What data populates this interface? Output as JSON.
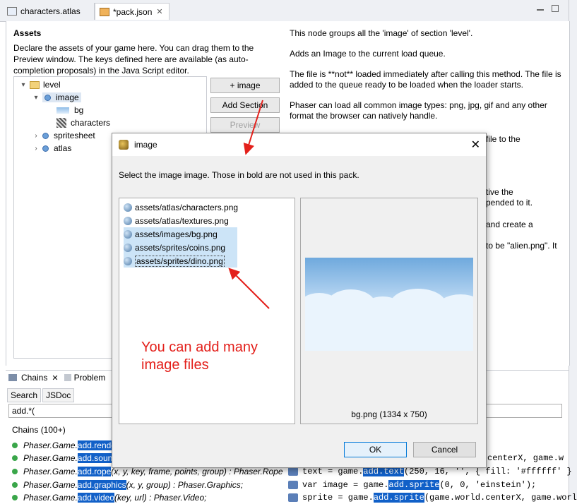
{
  "editor_tabs": [
    {
      "label": "characters.atlas",
      "icon": "atlas-file-icon"
    },
    {
      "label": "*pack.json",
      "icon": "pack-file-icon"
    }
  ],
  "assets_section": {
    "title": "Assets",
    "description": "Declare the assets of your game here. You can drag them to the Preview window. The keys defined here are available (as auto-completion proposals) in the Java Script editor.",
    "tree": [
      {
        "label": "level",
        "icon": "folder-icon"
      },
      {
        "label": "image",
        "icon": "section-icon"
      },
      {
        "label": "bg",
        "icon": "image-thumbnail-icon"
      },
      {
        "label": "characters",
        "icon": "atlas-thumbnail-icon"
      },
      {
        "label": "spritesheet",
        "icon": "section-icon"
      },
      {
        "label": "atlas",
        "icon": "section-icon"
      }
    ],
    "buttons": {
      "add_image": "+ image",
      "add_section": "Add Section",
      "preview": "Preview"
    }
  },
  "help_text": [
    "This node groups all the 'image' of section 'level'.",
    "Adds an Image to the current load queue.",
    "The file is **not** loaded immediately after calling this method. The file is added to the queue ready to be loaded when the loader starts.",
    "Phaser can load all common image types: png, jpg, gif and any other format the browser can natively handle."
  ],
  "help_fragments": [
    "file to the",
    "tive the",
    "pended to it.",
    "and create a",
    "to be \"alien.png\". It"
  ],
  "dialog": {
    "title": "image",
    "message": "Select the image image. Those in bold are not used in this pack.",
    "files": [
      {
        "path": "assets/atlas/characters.png",
        "selected": false
      },
      {
        "path": "assets/atlas/textures.png",
        "selected": false
      },
      {
        "path": "assets/images/bg.png",
        "selected": true
      },
      {
        "path": "assets/sprites/coins.png",
        "selected": true
      },
      {
        "path": "assets/sprites/dino.png",
        "selected": true
      }
    ],
    "preview_caption": "bg.png (1334 x 750)",
    "ok_label": "OK",
    "cancel_label": "Cancel"
  },
  "annotation": "You can add many image files",
  "bottom_panel": {
    "tabs": [
      "Chains",
      "Problem"
    ],
    "subtabs": [
      "Search",
      "JSDoc"
    ],
    "query": "add.*(",
    "chains_label": "Chains (100+)",
    "chains": [
      {
        "prefix": "Phaser.Game.",
        "match": "add.rende",
        "rest": ""
      },
      {
        "prefix": "Phaser.Game.",
        "match": "add.sound",
        "rest": ""
      },
      {
        "prefix": "Phaser.Game.",
        "match": "add.rope",
        "rest": "(x, y, key, frame, points, group) : Phaser.Rope"
      },
      {
        "prefix": "Phaser.Game.",
        "match": "add.graphics",
        "rest": "(x, y, group) : Phaser.Graphics;"
      },
      {
        "prefix": "Phaser.Game.",
        "match": "add.video",
        "rest": "(key, url) : Phaser.Video;"
      }
    ],
    "code_lines": [
      {
        "pre": "",
        "match": "",
        "rest": "centerX, game.w"
      },
      {
        "pre": "text = game.",
        "match": "add.text",
        "rest": "(250, 16, '', { fill: '#ffffff' }"
      },
      {
        "pre": "var image = game.",
        "match": "add.sprite",
        "rest": "(0, 0, 'einstein');"
      },
      {
        "pre": "sprite = game.",
        "match": "add.sprite",
        "rest": "(game.world.centerX, game.worl"
      }
    ]
  },
  "colors": {
    "annotation": "#e3201b",
    "selection": "#1160c8",
    "list_selection": "#cce4f7"
  }
}
